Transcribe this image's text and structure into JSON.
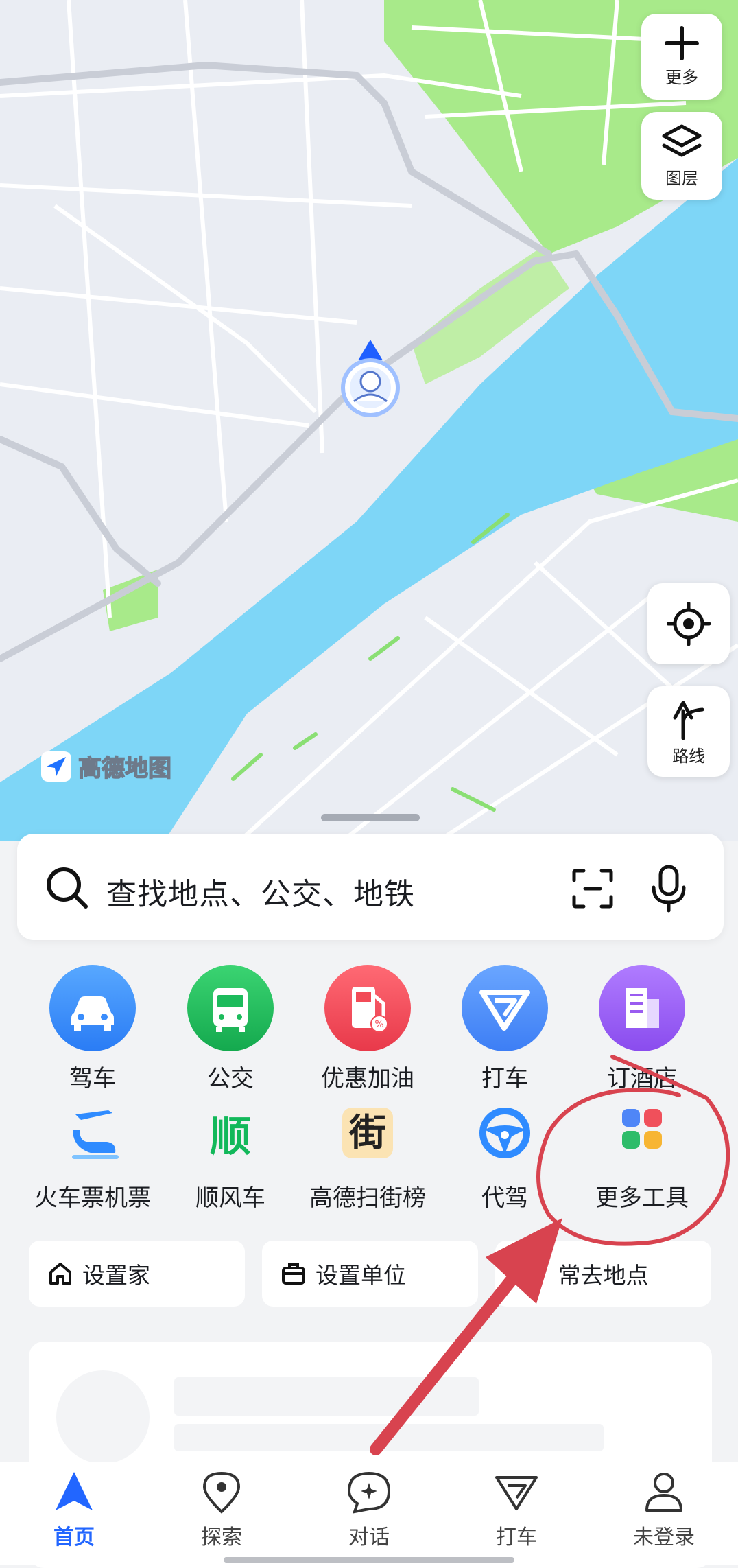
{
  "map": {
    "watermark": "高德地图",
    "more_label": "更多",
    "layers_label": "图层",
    "route_label": "路线"
  },
  "search": {
    "placeholder": "查找地点、公交、地铁"
  },
  "tools_row1": [
    {
      "label": "驾车",
      "icon": "car-icon",
      "color": "#3a8dfc"
    },
    {
      "label": "公交",
      "icon": "bus-icon",
      "color": "#1dbb5c"
    },
    {
      "label": "优惠加油",
      "icon": "fuel-icon",
      "color": "#f24b57"
    },
    {
      "label": "打车",
      "icon": "taxi-icon",
      "color": "#4c8dff"
    },
    {
      "label": "订酒店",
      "icon": "hotel-icon",
      "color": "#9a5cf0"
    }
  ],
  "tools_row2": [
    {
      "label": "火车票机票",
      "icon": "train-plane-icon"
    },
    {
      "label": "顺风车",
      "icon": "carpool-icon",
      "glyph": "顺"
    },
    {
      "label": "高德扫街榜",
      "icon": "street-rank-icon",
      "glyph": "街"
    },
    {
      "label": "代驾",
      "icon": "steering-wheel-icon"
    },
    {
      "label": "更多工具",
      "icon": "more-tools-icon"
    }
  ],
  "quick": {
    "home": "设置家",
    "work": "设置单位",
    "frequent": "常去地点"
  },
  "nav": [
    {
      "label": "首页",
      "icon": "home-nav-icon"
    },
    {
      "label": "探索",
      "icon": "explore-pin-icon"
    },
    {
      "label": "对话",
      "icon": "chat-icon"
    },
    {
      "label": "打车",
      "icon": "taxi-nav-icon"
    },
    {
      "label": "未登录",
      "icon": "user-icon"
    }
  ],
  "colors": {
    "accent": "#2266ff",
    "annotation": "#d8434f",
    "water": "#7ed6f7",
    "park": "#a8ea8a"
  }
}
